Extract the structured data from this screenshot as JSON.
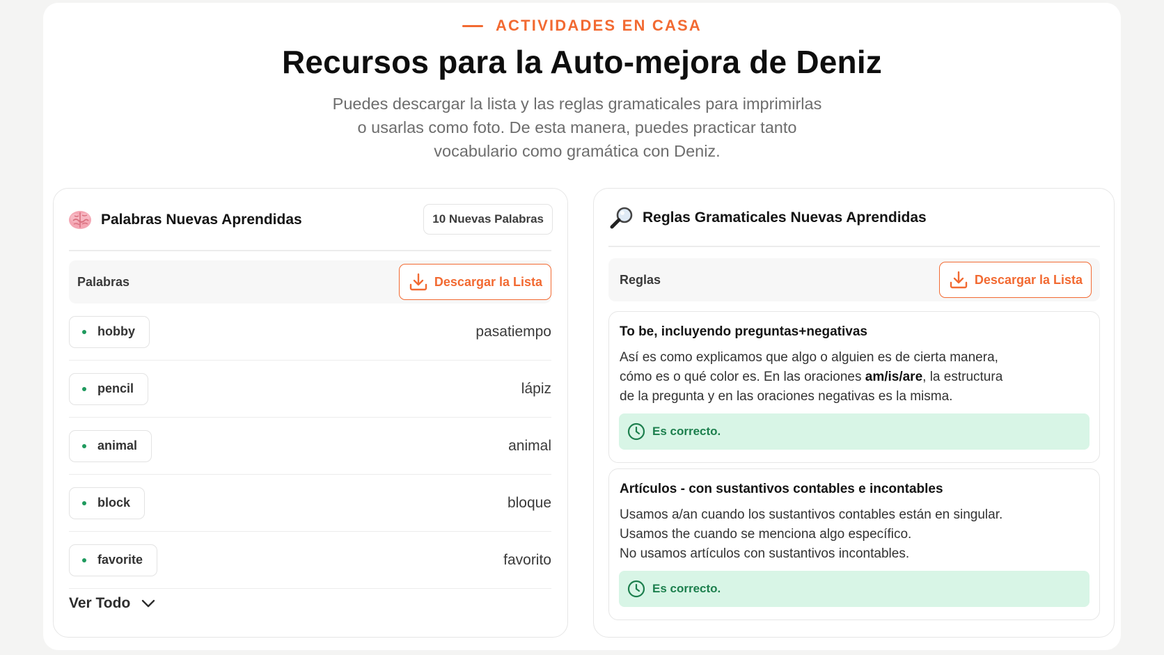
{
  "section": {
    "eyebrow": "ACTIVIDADES EN CASA",
    "title": "Recursos para la Auto-mejora de Deniz",
    "subtitle_lines": [
      "Puedes descargar la lista y las reglas gramaticales para imprimirlas",
      "o usarlas como foto. De esta manera, puedes practicar tanto",
      "vocabulario como gramática con Deniz."
    ]
  },
  "words_card": {
    "icon": "brain-icon",
    "title": "Palabras Nuevas Aprendidas",
    "badge": "10 Nuevas Palabras",
    "list_label": "Palabras",
    "download_label": "Descargar la Lista",
    "words": [
      {
        "word": "hobby",
        "translation": "pasatiempo"
      },
      {
        "word": "pencil",
        "translation": "lápiz"
      },
      {
        "word": "animal",
        "translation": "animal"
      },
      {
        "word": "block",
        "translation": "bloque"
      },
      {
        "word": "favorite",
        "translation": "favorito"
      }
    ],
    "see_all": "Ver Todo"
  },
  "rules_card": {
    "icon": "magnifier-icon",
    "title": "Reglas Gramaticales Nuevas Aprendidas",
    "list_label": "Reglas",
    "download_label": "Descargar la Lista",
    "rules": [
      {
        "title": "To be, incluyendo preguntas+negativas",
        "desc_1": "Así es como explicamos que algo o alguien es de cierta manera,",
        "desc_2a": "cómo es o qué color es. En las oraciones ",
        "desc_2b": "am/is/are",
        "desc_2c": ", la estructura",
        "desc_3": "de la pregunta y en las oraciones negativas es la misma.",
        "status": "Es correcto."
      },
      {
        "title": "Artículos - con sustantivos contables e incontables",
        "desc_1": "Usamos a/an cuando los sustantivos contables están en singular.",
        "desc_2": "Usamos the cuando se menciona algo específico.",
        "desc_3": "No usamos artículos con sustantivos incontables.",
        "status": "Es correcto."
      }
    ]
  },
  "colors": {
    "accent": "#f26a32",
    "success_bg": "#d8f5e6",
    "success_text": "#1c7f4d"
  }
}
